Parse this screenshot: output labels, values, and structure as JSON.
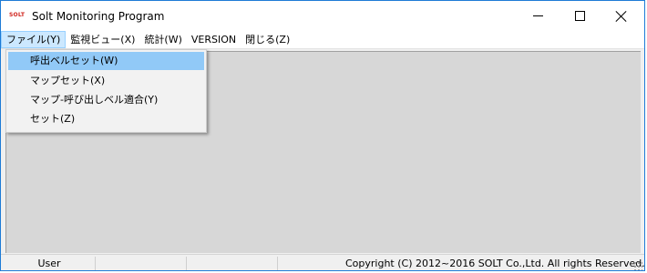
{
  "window": {
    "logo_text": "SOLT",
    "title": "Solt Monitoring Program",
    "accent_color": "#1e7bd6"
  },
  "menubar": {
    "items": [
      {
        "label": "ファイル(Y)",
        "active": true
      },
      {
        "label": "監視ビュー(X)"
      },
      {
        "label": "統計(W)"
      },
      {
        "label": "VERSION"
      },
      {
        "label": "閉じる(Z)"
      }
    ]
  },
  "file_menu": {
    "items": [
      {
        "label": "呼出ベルセット(W)",
        "highlighted": true
      },
      {
        "label": "マップセット(X)"
      },
      {
        "label": "マップ-呼び出しベル適合(Y)"
      },
      {
        "label": "セット(Z)"
      }
    ]
  },
  "statusbar": {
    "user": "User",
    "copyright": "Copyright (C) 2012~2016 SOLT Co.,Ltd. All rights Reserved."
  },
  "icons": {
    "minimize": "minimize-icon",
    "maximize": "maximize-icon",
    "close": "close-icon",
    "resize_grip": "resize-grip-icon"
  }
}
